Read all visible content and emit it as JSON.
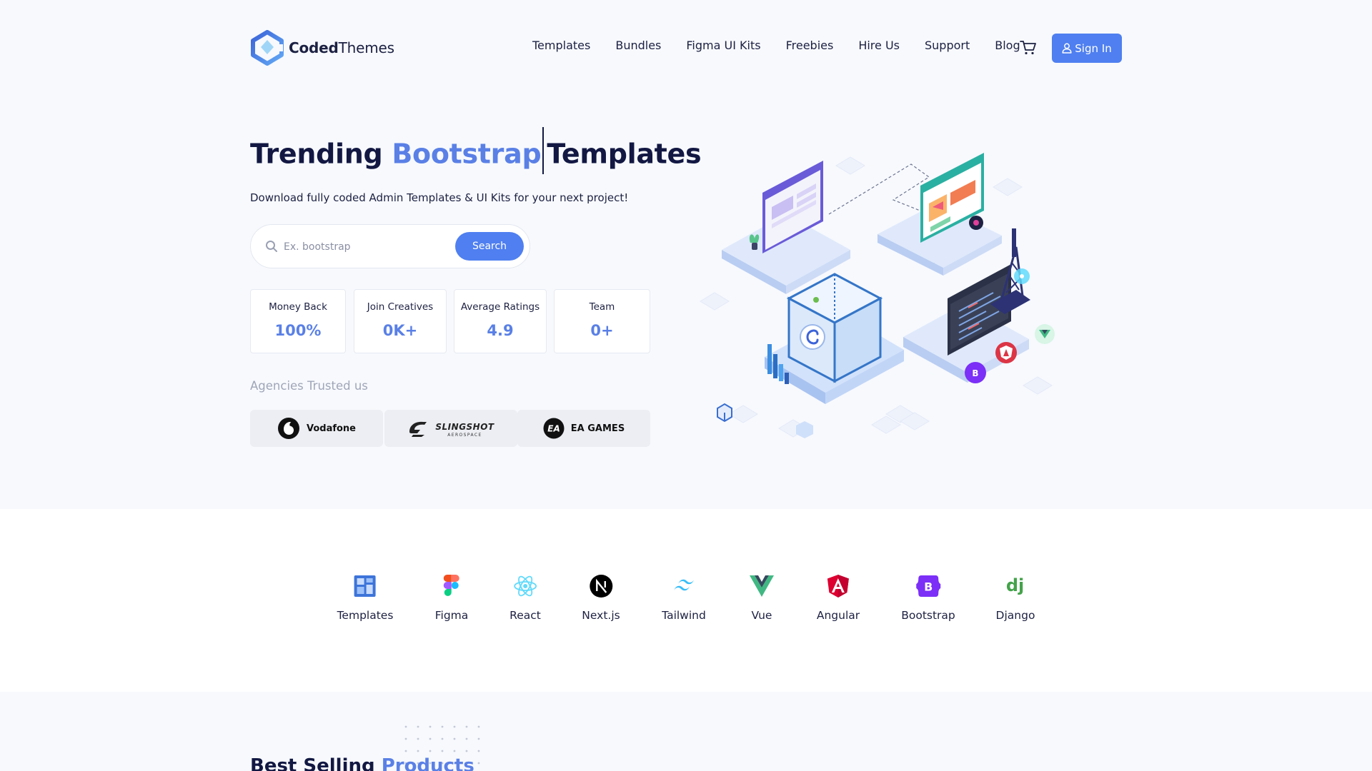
{
  "brand": {
    "name_bold": "Coded",
    "name_light": "Themes"
  },
  "nav": {
    "items": [
      "Templates",
      "Bundles",
      "Figma UI Kits",
      "Freebies",
      "Hire Us",
      "Support",
      "Blog"
    ],
    "sign_in": "Sign In"
  },
  "hero": {
    "title_prefix": "Trending",
    "title_accent": "Bootstrap",
    "title_suffix": "Templates",
    "subtitle": "Download fully coded Admin Templates & UI Kits for your next project!",
    "search": {
      "placeholder": "Ex. bootstrap",
      "value": "",
      "button": "Search"
    },
    "stats": [
      {
        "label": "Money Back",
        "value": "100%"
      },
      {
        "label": "Join Creatives",
        "value": "0K+"
      },
      {
        "label": "Average Ratings",
        "value": "4.9"
      },
      {
        "label": "Team",
        "value": "0+"
      }
    ],
    "agencies_title": "Agencies Trusted us",
    "agencies": {
      "vodafone": "Vodafone",
      "slingshot": "SLINGSHOT",
      "slingshot_sub": "AEROSPACE",
      "ea": "EA GAMES"
    }
  },
  "tech": [
    {
      "label": "Templates",
      "icon": "templates-icon"
    },
    {
      "label": "Figma",
      "icon": "figma-icon"
    },
    {
      "label": "React",
      "icon": "react-icon"
    },
    {
      "label": "Next.js",
      "icon": "nextjs-icon"
    },
    {
      "label": "Tailwind",
      "icon": "tailwind-icon"
    },
    {
      "label": "Vue",
      "icon": "vue-icon"
    },
    {
      "label": "Angular",
      "icon": "angular-icon"
    },
    {
      "label": "Bootstrap",
      "icon": "bootstrap-icon"
    },
    {
      "label": "Django",
      "icon": "django-icon"
    }
  ],
  "best_selling": {
    "prefix": "Best Selling",
    "accent": "Products"
  },
  "colors": {
    "accent": "#4f7ff0",
    "accent_text": "#5a80e6",
    "heading": "#121842",
    "background": "#f7f9fd"
  }
}
